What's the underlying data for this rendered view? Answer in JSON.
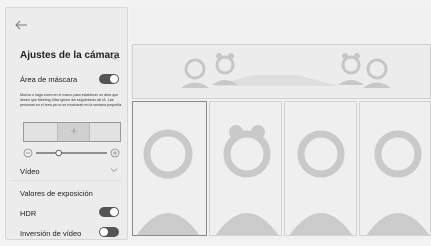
{
  "panel": {
    "title": "Ajustes de la cámara",
    "mask_label": "Área de máscara",
    "mask_enabled": true,
    "mask_description": "Mueva o haga zoom en el marco para establecer un área que desee que Meeting Ultra ignore del seguimiento de IA. Las personas en el área ya no se mostrarán en la ventana pequeña.",
    "video_label": "Vídeo",
    "exposure_label": "Valores de exposición",
    "hdr_label": "HDR",
    "hdr_enabled": true,
    "invert_label": "Inversión de vídeo",
    "invert_enabled": false,
    "zoom_level": 0.32
  },
  "colors": {
    "panel_bg": "#ececec",
    "toggle_on": "#555555",
    "icon_gray": "#c8c8c8"
  }
}
